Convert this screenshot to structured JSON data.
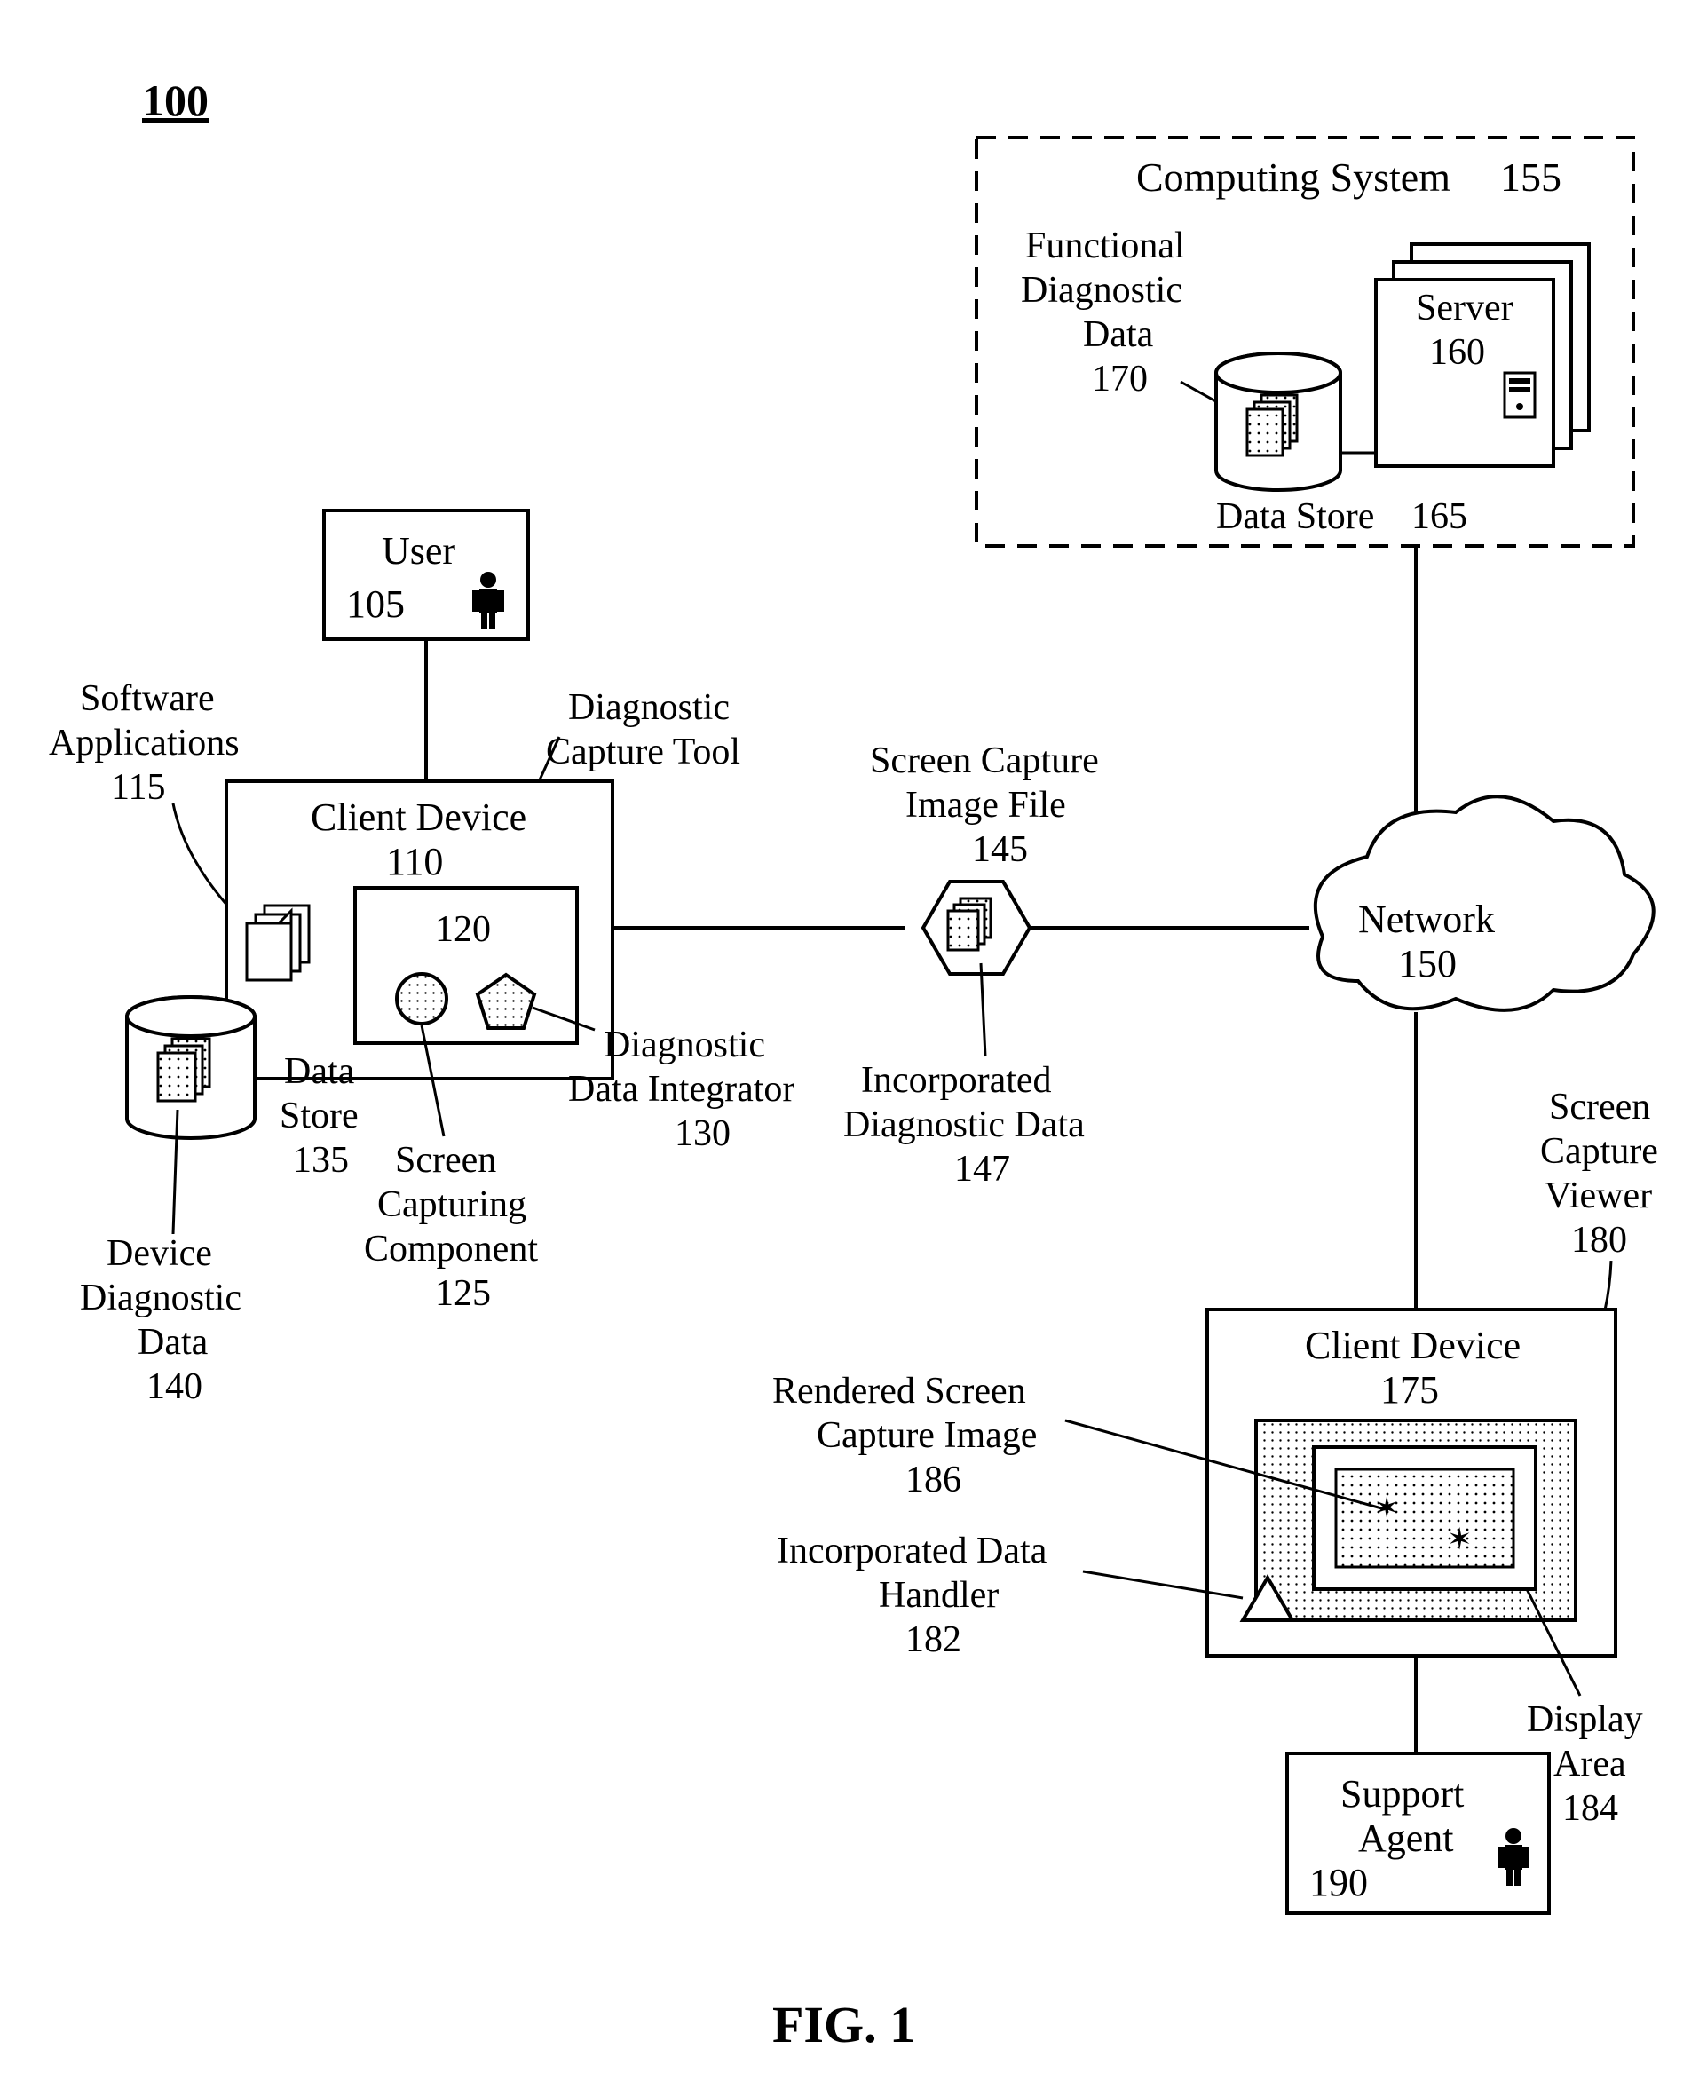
{
  "figure": {
    "number_label": "100",
    "caption": "FIG. 1"
  },
  "user": {
    "label": "User",
    "num": "105"
  },
  "client1": {
    "label": "Client Device",
    "num": "110"
  },
  "swapps": {
    "label": "Software Applications",
    "num": "115"
  },
  "tool": {
    "label": "Diagnostic Capture Tool",
    "num": "120"
  },
  "scc": {
    "label": "Screen Capturing Component",
    "num": "125"
  },
  "ddi": {
    "label": "Diagnostic Data Integrator",
    "num": "130"
  },
  "ds1": {
    "label": "Data Store",
    "num": "135"
  },
  "ddd": {
    "label": "Device Diagnostic Data",
    "num": "140"
  },
  "scif": {
    "label": "Screen Capture Image File",
    "num": "145"
  },
  "idd": {
    "label": "Incorporated Diagnostic Data",
    "num": "147"
  },
  "net": {
    "label": "Network",
    "num": "150"
  },
  "cs": {
    "label": "Computing System",
    "num": "155"
  },
  "server": {
    "label": "Server",
    "num": "160"
  },
  "ds2": {
    "label": "Data Store",
    "num": "165"
  },
  "fdd": {
    "label": "Functional Diagnostic Data",
    "num": "170"
  },
  "client2": {
    "label": "Client Device",
    "num": "175"
  },
  "scv": {
    "label": "Screen Capture Viewer",
    "num": "180"
  },
  "idh": {
    "label": "Incorporated Data Handler",
    "num": "182"
  },
  "da": {
    "label": "Display Area",
    "num": "184"
  },
  "rsci": {
    "label": "Rendered Screen Capture Image",
    "num": "186"
  },
  "agent": {
    "label": "Support Agent",
    "num": "190"
  }
}
